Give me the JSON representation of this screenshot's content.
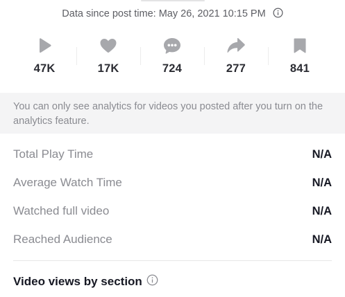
{
  "header": {
    "data_since": "Data since post time: May 26, 2021 10:15 PM"
  },
  "stats": [
    {
      "icon": "play-icon",
      "value": "47K"
    },
    {
      "icon": "heart-icon",
      "value": "17K"
    },
    {
      "icon": "comment-icon",
      "value": "724"
    },
    {
      "icon": "share-icon",
      "value": "277"
    },
    {
      "icon": "bookmark-icon",
      "value": "841"
    }
  ],
  "notice": {
    "text": "You can only see analytics for videos you posted after you turn on the analytics feature."
  },
  "metrics": [
    {
      "label": "Total Play Time",
      "value": "N/A"
    },
    {
      "label": "Average Watch Time",
      "value": "N/A"
    },
    {
      "label": "Watched full video",
      "value": "N/A"
    },
    {
      "label": "Reached Audience",
      "value": "N/A"
    }
  ],
  "section": {
    "title": "Video views by section"
  },
  "colors": {
    "icon_gray": "#a7a8ac",
    "label_gray": "#8a8b91",
    "notice_bg": "#f4f4f5"
  }
}
